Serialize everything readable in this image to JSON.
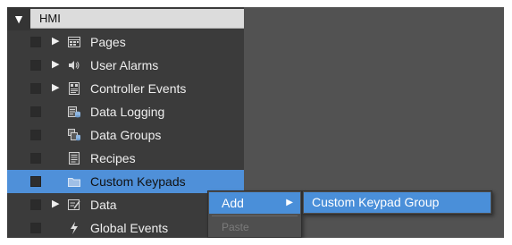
{
  "tree": {
    "root": {
      "toggle_glyph": "▼",
      "label": "HMI"
    },
    "items": [
      {
        "label": "Pages",
        "icon": "pages-icon",
        "expander": "▶"
      },
      {
        "label": "User Alarms",
        "icon": "speaker-icon",
        "expander": "▶"
      },
      {
        "label": "Controller Events",
        "icon": "controller-events-icon",
        "expander": "▶"
      },
      {
        "label": "Data Logging",
        "icon": "data-logging-icon",
        "expander": ""
      },
      {
        "label": "Data Groups",
        "icon": "data-groups-icon",
        "expander": ""
      },
      {
        "label": "Recipes",
        "icon": "recipes-icon",
        "expander": ""
      },
      {
        "label": "Custom Keypads",
        "icon": "folder-icon",
        "expander": "",
        "selected": true
      },
      {
        "label": "Data",
        "icon": "data-icon",
        "expander": "▶"
      },
      {
        "label": "Global Events",
        "icon": "lightning-icon",
        "expander": ""
      }
    ]
  },
  "context_menu": {
    "add_label": "Add",
    "add_arrow": "▶",
    "paste_label": "Paste"
  },
  "submenu": {
    "item_label": "Custom Keypad Group"
  },
  "colors": {
    "tree_bg": "#3b3b3b",
    "right_bg": "#525252",
    "selection": "#4f90d9",
    "menu_highlight": "#4a8fd9"
  }
}
